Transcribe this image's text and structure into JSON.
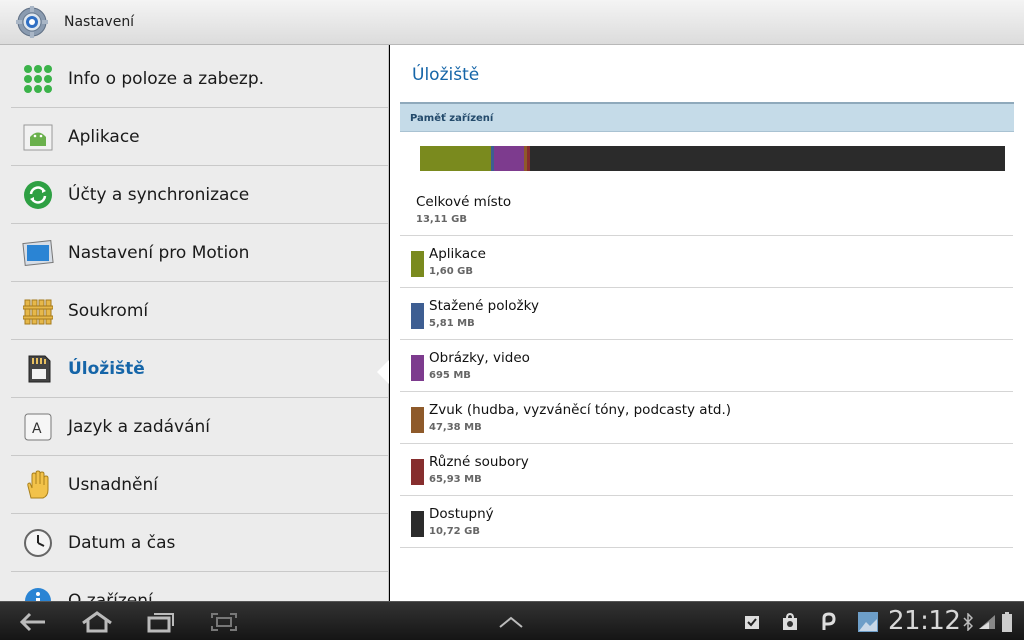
{
  "app": {
    "title": "Nastavení"
  },
  "sidebar": {
    "items": [
      {
        "label": "Info o poloze a zabezp.",
        "icon": "location-security-icon"
      },
      {
        "label": "Aplikace",
        "icon": "android-apps-icon"
      },
      {
        "label": "Účty a synchronizace",
        "icon": "sync-icon"
      },
      {
        "label": "Nastavení pro Motion",
        "icon": "motion-icon"
      },
      {
        "label": "Soukromí",
        "icon": "privacy-fence-icon"
      },
      {
        "label": "Úložiště",
        "icon": "sd-card-icon",
        "active": true
      },
      {
        "label": "Jazyk a zadávání",
        "icon": "keyboard-icon"
      },
      {
        "label": "Usnadnění",
        "icon": "hand-icon"
      },
      {
        "label": "Datum a čas",
        "icon": "clock-icon"
      },
      {
        "label": "O zařízení",
        "icon": "info-icon"
      }
    ]
  },
  "content": {
    "title": "Úložiště",
    "section_header": "Paměť zařízení",
    "total": {
      "label": "Celkové místo",
      "size": "13,11 GB"
    },
    "categories": [
      {
        "label": "Aplikace",
        "size": "1,60 GB",
        "color": "#7a8a1e"
      },
      {
        "label": "Stažené položky",
        "size": "5,81 MB",
        "color": "#3e5e92"
      },
      {
        "label": "Obrázky, video",
        "size": "695 MB",
        "color": "#7d3b8e"
      },
      {
        "label": "Zvuk (hudba, vyzváněcí tóny, podcasty atd.)",
        "size": "47,38 MB",
        "color": "#8e5a2a"
      },
      {
        "label": "Různé soubory",
        "size": "65,93 MB",
        "color": "#862e2e"
      },
      {
        "label": "Dostupný",
        "size": "10,72 GB",
        "color": "#2b2b2b"
      }
    ],
    "usage_fractions": [
      0.122,
      0.0005,
      0.052,
      0.0035,
      0.0049,
      0.817
    ]
  },
  "statusbar": {
    "time": "21:12"
  }
}
